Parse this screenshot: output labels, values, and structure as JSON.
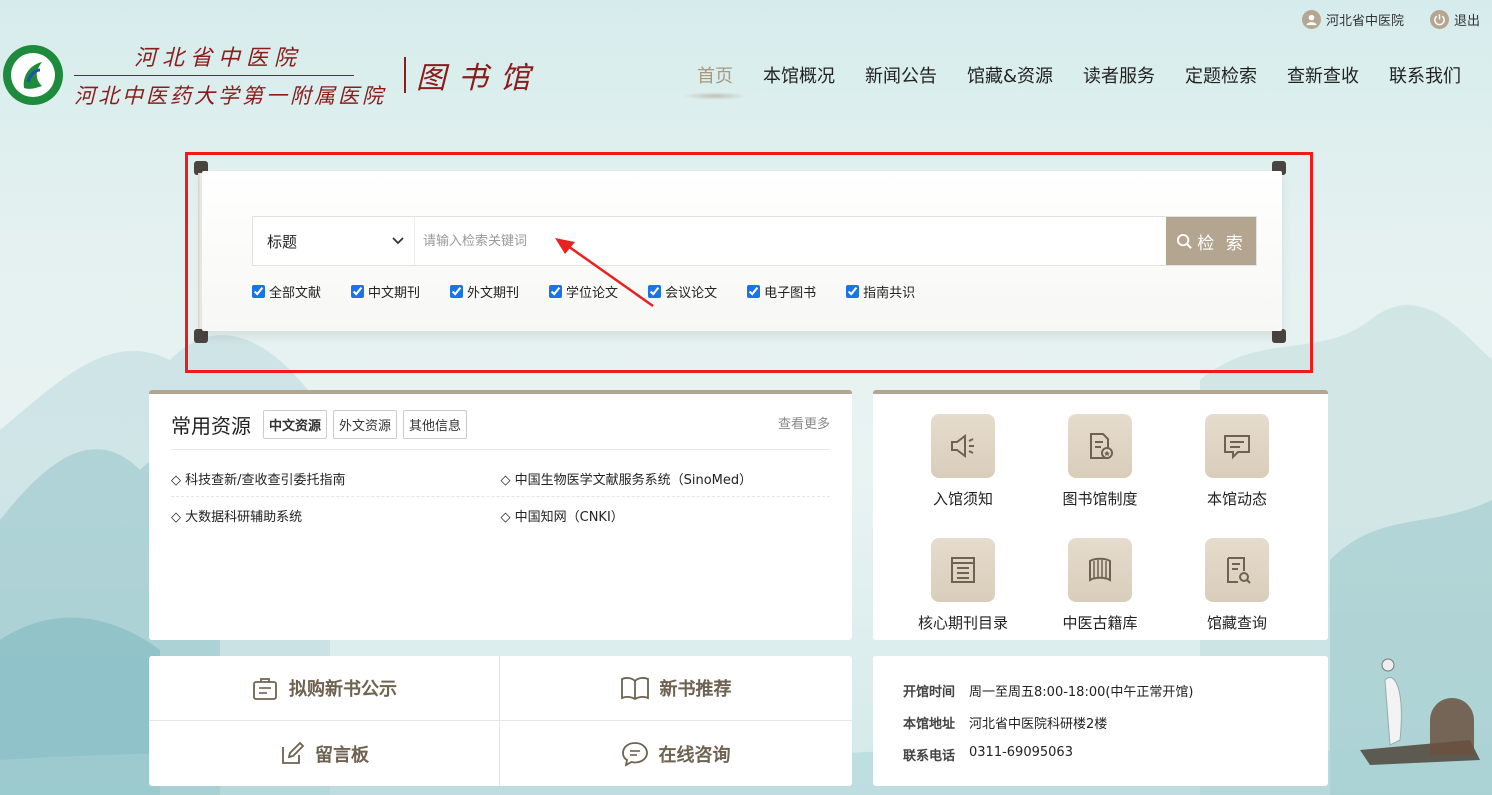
{
  "topbar": {
    "user_label": "河北省中医院",
    "logout_label": "退出"
  },
  "logo": {
    "line1": "河北省中医院",
    "line2": "河北中医药大学第一附属医院",
    "library": "图书馆",
    "colors": {
      "brand": "#8a1c1c",
      "emblem": "#1e8a3c"
    }
  },
  "nav": {
    "items": [
      {
        "label": "首页",
        "active": true
      },
      {
        "label": "本馆概况"
      },
      {
        "label": "新闻公告"
      },
      {
        "label": "馆藏&资源"
      },
      {
        "label": "读者服务"
      },
      {
        "label": "定题检索"
      },
      {
        "label": "查新查收"
      },
      {
        "label": "联系我们"
      }
    ],
    "active_color": "#a89880"
  },
  "search": {
    "field_selected": "标题",
    "placeholder": "请输入检索关键词",
    "button_label": "检 索",
    "button_color": "#b3a58f",
    "highlight_color": "#f01a1a",
    "checkboxes": [
      {
        "label": "全部文献",
        "checked": true
      },
      {
        "label": "中文期刊",
        "checked": true
      },
      {
        "label": "外文期刊",
        "checked": true
      },
      {
        "label": "学位论文",
        "checked": true
      },
      {
        "label": "会议论文",
        "checked": true
      },
      {
        "label": "电子图书",
        "checked": true
      },
      {
        "label": "指南共识",
        "checked": true
      }
    ]
  },
  "resources": {
    "title": "常用资源",
    "tabs": [
      {
        "label": "中文资源",
        "active": true
      },
      {
        "label": "外文资源"
      },
      {
        "label": "其他信息"
      }
    ],
    "more_label": "查看更多",
    "rows": [
      [
        "◇ 科技查新/查收查引委托指南",
        "◇ 中国生物医学文献服务系统（SinoMed）"
      ],
      [
        "◇ 大数据科研辅助系统",
        "◇ 中国知网（CNKI）"
      ]
    ]
  },
  "services": [
    {
      "label": "入馆须知",
      "icon": "speaker-icon"
    },
    {
      "label": "图书馆制度",
      "icon": "document-star-icon"
    },
    {
      "label": "本馆动态",
      "icon": "message-icon"
    },
    {
      "label": "核心期刊目录",
      "icon": "list-book-icon"
    },
    {
      "label": "中医古籍库",
      "icon": "bamboo-scroll-icon"
    },
    {
      "label": "馆藏查询",
      "icon": "search-document-icon"
    }
  ],
  "quick_links": [
    {
      "label": "拟购新书公示",
      "icon": "clipboard-icon"
    },
    {
      "label": "新书推荐",
      "icon": "open-book-icon"
    },
    {
      "label": "留言板",
      "icon": "edit-icon"
    },
    {
      "label": "在线咨询",
      "icon": "chat-icon"
    }
  ],
  "info": {
    "hours_key": "开馆时间",
    "hours_val": "周一至周五8:00-18:00(中午正常开馆)",
    "addr_key": "本馆地址",
    "addr_val": "河北省中医院科研楼2楼",
    "phone_key": "联系电话",
    "phone_val": "0311-69095063"
  }
}
